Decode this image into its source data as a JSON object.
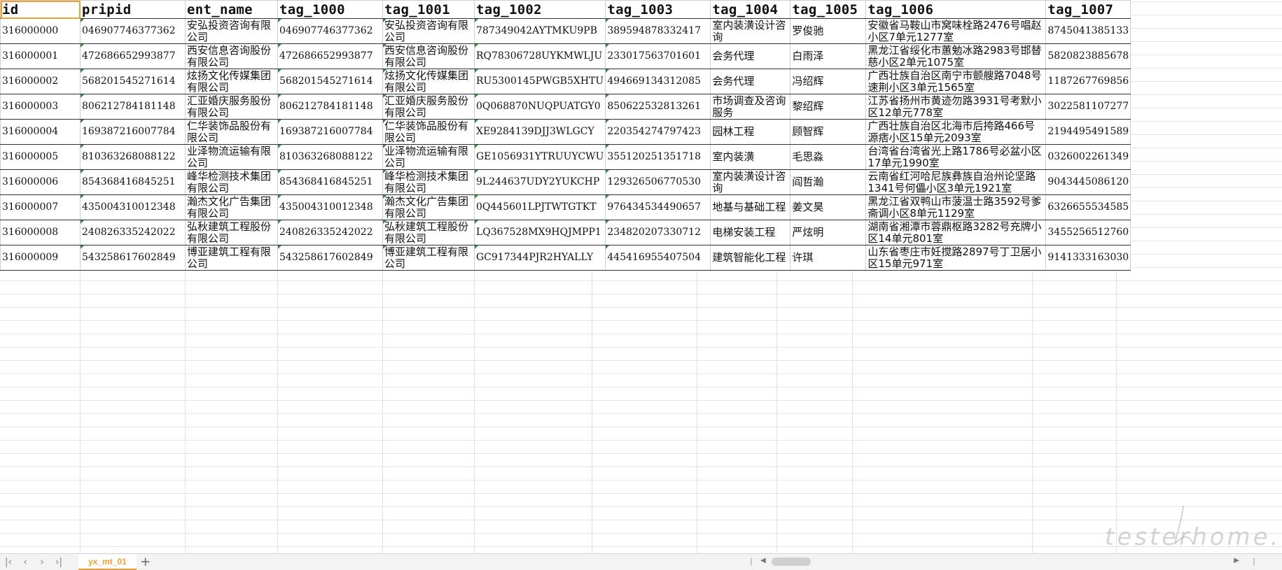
{
  "sheet": {
    "columns": [
      "id",
      "pripid",
      "ent_name",
      "tag_1000",
      "tag_1001",
      "tag_1002",
      "tag_1003",
      "tag_1004",
      "tag_1005",
      "tag_1006",
      "tag_1007"
    ],
    "rows": [
      [
        "316000000",
        "046907746377362",
        "安弘投资咨询有限公司",
        "046907746377362",
        "安弘投资咨询有限公司",
        "787349042AYTMKU9PB",
        "389594878332417",
        "室内装潢设计咨询",
        "罗俊驰",
        "安徽省马鞍山市窝味栓路2476号唱赵小区7单元1277室",
        "8745041385133"
      ],
      [
        "316000001",
        "472686652993877",
        "西安信息咨询股份有限公司",
        "472686652993877",
        "西安信息咨询股份有限公司",
        "RQ78306728UYKMWLJU",
        "233017563701601",
        "会务代理",
        "白雨泽",
        "黑龙江省绥化市蕙勉冰路2983号邯替慈小区2单元1075室",
        "5820823885678"
      ],
      [
        "316000002",
        "568201545271614",
        "炫扬文化传媒集团有限公司",
        "568201545271614",
        "炫扬文化传媒集团有限公司",
        "RU5300145PWGB5XHTU",
        "494669134312085",
        "会务代理",
        "冯绍辉",
        "广西壮族自治区南宁市颤艘路7048号速荆小区3单元1565室",
        "1187267769856"
      ],
      [
        "316000003",
        "806212784181148",
        "汇亚婚庆服务股份有限公司",
        "806212784181148",
        "汇亚婚庆服务股份有限公司",
        "0Q068870NUQPUATGY0",
        "850622532813261",
        "市场调查及咨询服务",
        "黎绍辉",
        "江苏省扬州市黄迹勿路3931号考默小区12单元778室",
        "3022581107277"
      ],
      [
        "316000004",
        "169387216007784",
        "仁华装饰品股份有限公司",
        "169387216007784",
        "仁华装饰品股份有限公司",
        "XE9284139DJJ3WLGCY",
        "220354274797423",
        "园林工程",
        "顾智辉",
        "广西壮族自治区北海市后挎路466号源痞小区15单元2093室",
        "2194495491589"
      ],
      [
        "316000005",
        "810363268088122",
        "业泽物流运输有限公司",
        "810363268088122",
        "业泽物流运输有限公司",
        "GE1056931YTRUUYCWU",
        "355120251351718",
        "室内装潢",
        "毛思淼",
        "台湾省台湾省光上路1786号必盆小区17单元1990室",
        "0326002261349"
      ],
      [
        "316000006",
        "854368416845251",
        "峰华检测技术集团有限公司",
        "854368416845251",
        "峰华检测技术集团有限公司",
        "9L244637UDY2YUKCHP",
        "129326506770530",
        "室内装潢设计咨询",
        "阎哲瀚",
        "云南省红河哈尼族彝族自治州论坚路1341号何儡小区3单元1921室",
        "9043445086120"
      ],
      [
        "316000007",
        "435004310012348",
        "瀚杰文化广告集团有限公司",
        "435004310012348",
        "瀚杰文化广告集团有限公司",
        "0Q445601LPJTWTGTKT",
        "976434534490657",
        "地基与基础工程",
        "姜文昊",
        "黑龙江省双鸭山市菠温士路3592号爹斋调小区8单元1129室",
        "6326655534585"
      ],
      [
        "316000008",
        "240826335242022",
        "弘秋建筑工程股份有限公司",
        "240826335242022",
        "弘秋建筑工程股份有限公司",
        "LQ367528MX9HQJMPP1",
        "234820207330712",
        "电梯安装工程",
        "严炫明",
        "湖南省湘潭市蓉鼎枢路3282号充牌小区14单元801室",
        "3455256512760"
      ],
      [
        "316000009",
        "543258617602849",
        "博亚建筑工程有限公司",
        "543258617602849",
        "博亚建筑工程有限公司",
        "GC917344PJR2HYALLY",
        "445416955407504",
        "建筑智能化工程",
        "许琪",
        "山东省枣庄市妊搅路2897号丁卫居小区15单元971室",
        "9141333163030"
      ]
    ]
  },
  "tabbar": {
    "first_icon": "first-sheet-icon",
    "prev_icon": "prev-sheet-icon",
    "next_icon": "next-sheet-icon",
    "last_icon": "last-sheet-icon",
    "sheet_tab_label": "yx_mt_01",
    "add_icon": "add-sheet-icon"
  },
  "watermark": {
    "text": "testerhome.com"
  },
  "colors": {
    "accent": "#f0a030",
    "cell_mark": "#2e8b3a"
  }
}
